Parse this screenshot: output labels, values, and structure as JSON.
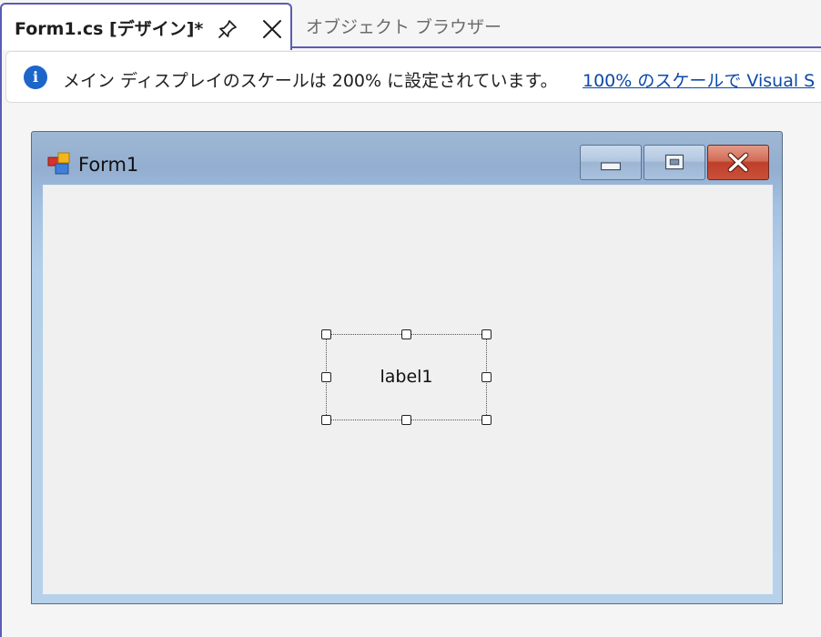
{
  "tabs": {
    "active": {
      "title": "Form1.cs [デザイン]*"
    },
    "inactive": {
      "title": "オブジェクト ブラウザー"
    }
  },
  "infobar": {
    "icon": "info-icon",
    "icon_glyph": "i",
    "message": "メイン ディスプレイのスケールは 200% に設定されています。",
    "link": "100% のスケールで Visual S"
  },
  "form": {
    "title": "Form1",
    "icon": "form-app-icon",
    "buttons": {
      "minimize": "minimize-icon",
      "maximize": "maximize-icon",
      "close": "close-icon"
    },
    "label": {
      "text": "label1",
      "selected": true
    }
  },
  "colors": {
    "accent": "#5b5bb6",
    "info_icon": "#1c65c9",
    "link": "#0b4aa8",
    "close_button": "#c9503a"
  }
}
